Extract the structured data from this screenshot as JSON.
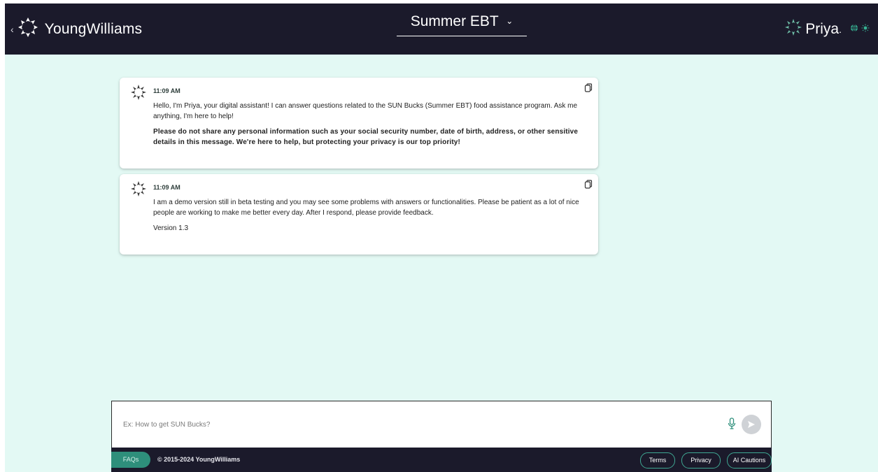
{
  "header": {
    "brand": "YoungWilliams",
    "title": "Summer EBT",
    "assistant_name": "Priya",
    "assistant_suffix": "."
  },
  "messages": [
    {
      "time": "11:09 AM",
      "paragraphs": [
        {
          "text": "Hello, I'm Priya, your digital assistant! I can answer questions related to the SUN Bucks (Summer EBT) food assistance program. Ask me anything, I'm here to help!",
          "bold": false
        },
        {
          "text": "Please do not share any personal information such as your social security number, date of birth, address, or other sensitive details in this message. We're here to help, but protecting your privacy is our top priority!",
          "bold": true
        }
      ]
    },
    {
      "time": "11:09 AM",
      "paragraphs": [
        {
          "text": "I am a demo version still in beta testing and you may see some problems with answers or functionalities. Please be patient as a lot of nice people are working to make me better every day. After I respond, please provide feedback.",
          "bold": false
        },
        {
          "text": "Version 1.3",
          "bold": false
        }
      ]
    }
  ],
  "input": {
    "placeholder": "Ex: How to get SUN Bucks?",
    "value": ""
  },
  "footer": {
    "faqs_label": "FAQs",
    "copyright": "© 2015-2024 YoungWilliams",
    "terms_label": "Terms",
    "privacy_label": "Privacy",
    "ai_cautions_label": "AI Cautions"
  },
  "icons": {
    "brand_logo": "young-williams-logo-icon",
    "assistant_logo": "priya-logo-icon",
    "globe": "globe-icon",
    "theme": "sun-icon",
    "copy": "copy-icon",
    "mic": "microphone-icon",
    "send": "send-icon"
  },
  "colors": {
    "header_bg": "#1b1a2b",
    "page_bg": "#e3f9f4",
    "accent": "#2e8f7b",
    "pill_border": "#3fa893",
    "send_disabled": "#cfd2d6"
  }
}
